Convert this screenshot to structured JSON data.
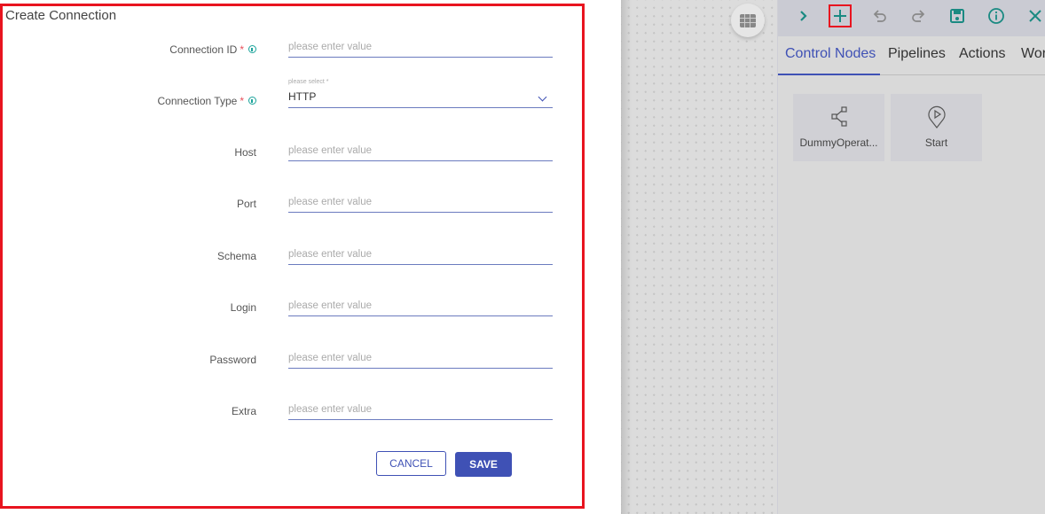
{
  "dialog": {
    "title": "Create Connection",
    "fields": [
      {
        "label": "Connection ID",
        "required": "*",
        "has_info": true,
        "type": "text",
        "value": "",
        "placeholder": "please enter value"
      },
      {
        "label": "Connection Type",
        "required": "*",
        "has_info": true,
        "type": "select",
        "hint": "please select *",
        "value": "HTTP"
      },
      {
        "label": "Host",
        "type": "text",
        "value": "",
        "placeholder": "please enter value"
      },
      {
        "label": "Port",
        "type": "text",
        "value": "",
        "placeholder": "please enter value"
      },
      {
        "label": "Schema",
        "type": "text",
        "value": "",
        "placeholder": "please enter value"
      },
      {
        "label": "Login",
        "type": "text",
        "value": "",
        "placeholder": "please enter value"
      },
      {
        "label": "Password",
        "type": "text",
        "value": "",
        "placeholder": "please enter value"
      },
      {
        "label": "Extra",
        "type": "text",
        "value": "",
        "placeholder": "please enter value"
      }
    ],
    "cancel_label": "CANCEL",
    "save_label": "SAVE"
  },
  "canvas": {
    "grid_button_icon": "table-grid-icon"
  },
  "panel": {
    "toolbar": [
      {
        "name": "expand",
        "icon": "chevron-right-icon"
      },
      {
        "name": "add",
        "icon": "plus-icon",
        "highlighted": true
      },
      {
        "name": "undo",
        "icon": "undo-icon"
      },
      {
        "name": "redo",
        "icon": "redo-icon"
      },
      {
        "name": "save",
        "icon": "save-icon"
      },
      {
        "name": "info",
        "icon": "info-icon"
      },
      {
        "name": "close",
        "icon": "close-icon"
      }
    ],
    "tabs": [
      {
        "label": "Control Nodes",
        "active": true
      },
      {
        "label": "Pipelines"
      },
      {
        "label": "Actions"
      },
      {
        "label": "Wor"
      }
    ],
    "nodes": [
      {
        "label": "DummyOperat...",
        "icon": "share-nodes-icon"
      },
      {
        "label": "Start",
        "icon": "play-pin-icon"
      }
    ]
  },
  "colors": {
    "accent": "#3f51b5",
    "teal": "#1a8a82",
    "highlight_border": "#e8141f"
  }
}
